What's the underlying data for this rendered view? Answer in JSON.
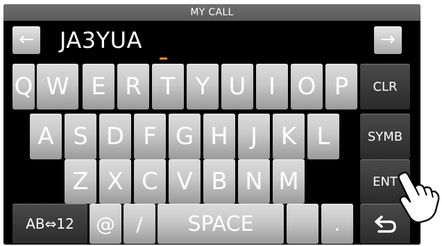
{
  "window": {
    "title": "MY CALL"
  },
  "input": {
    "value": "JA3YUA",
    "left_arrow": "←",
    "right_arrow": "→"
  },
  "keyboard": {
    "row1": [
      "Q",
      "W",
      "E",
      "R",
      "T",
      "Y",
      "U",
      "I",
      "O",
      "P"
    ],
    "row2": [
      "A",
      "S",
      "D",
      "F",
      "G",
      "H",
      "J",
      "K",
      "L"
    ],
    "row3": [
      "Z",
      "X",
      "C",
      "V",
      "B",
      "N",
      "M"
    ],
    "row4": {
      "mode": "AB⇔12",
      "at": "@",
      "slash": "/",
      "space": "SPACE",
      "dot": "."
    },
    "side": {
      "clr": "CLR",
      "symb": "SYMB",
      "ent": "ENT",
      "back": "↩"
    }
  },
  "colors": {
    "cursor": "#f08a1c",
    "key_light": "#c8c8c8",
    "key_dark": "#3a3a3a"
  }
}
